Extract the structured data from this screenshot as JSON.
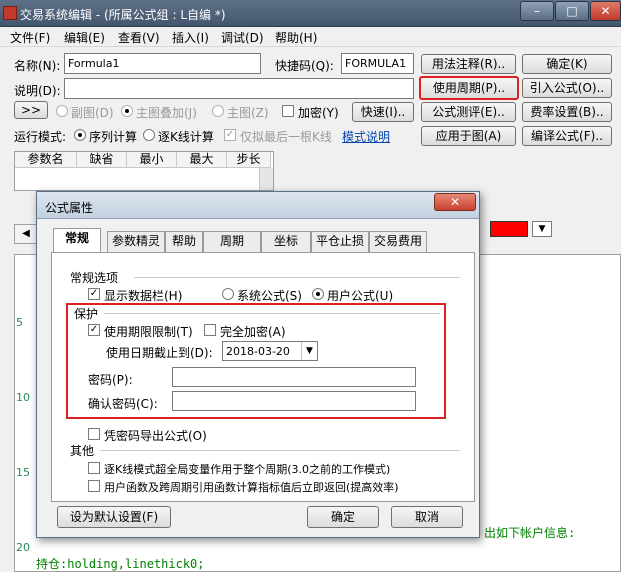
{
  "window": {
    "title": "交易系统编辑 - (所属公式组 : L自编 *)",
    "minimize": "–",
    "maximize": "□",
    "close": "✕"
  },
  "menu": [
    "文件(F)",
    "编辑(E)",
    "查看(V)",
    "插入(I)",
    "调试(D)",
    "帮助(H)"
  ],
  "form": {
    "name_label": "名称(N):",
    "name_value": "Formula1",
    "shortcut_label": "快捷码(Q):",
    "shortcut_value": "FORMULA1",
    "desc_label": "说明(D):",
    "desc_value": ""
  },
  "buttons": {
    "usage_note": "用法注释(R)..",
    "confirm": "确定(K)",
    "use_period": "使用周期(P)..",
    "import_formula": "引入公式(O)..",
    "formula_test": "公式测评(E)..",
    "fee_setting": "费率设置(B)..",
    "apply_to_chart": "应用于图(A)",
    "compile_formula": "编译公式(F)..",
    "expand": ">>",
    "quick": "快速(I).."
  },
  "options_row": {
    "subchart": "副图(D)",
    "main_overlay": "主图叠加(J)",
    "main_chart": "主图(Z)",
    "encrypt": "加密(Y)"
  },
  "run_mode": {
    "label": "运行模式:",
    "sequential": "序列计算",
    "bar_by_bar": "逐K线计算",
    "last_bar_only": "仅拟最后一根K线",
    "mode_help": "模式说明"
  },
  "param_table": {
    "headers": [
      "参数名",
      "缺省",
      "最小",
      "最大",
      "步长"
    ]
  },
  "editor": {
    "line_numbers": [
      "5",
      "10",
      "15",
      "20"
    ],
    "last_line": "持仓:holding,linethick0;",
    "side_text": "出如下帐户信息:"
  },
  "dialog": {
    "title": "公式属性",
    "close": "✕",
    "tabs": [
      "常规",
      "参数精灵",
      "帮助",
      "周期",
      "坐标",
      "平仓止损",
      "交易费用"
    ],
    "active_tab": "常规",
    "general_options": {
      "heading": "常规选项",
      "show_data_bar": "显示数据栏(H)",
      "show_data_bar_checked": true,
      "system_formula": "系统公式(S)",
      "user_formula": "用户公式(U)",
      "selected": "用户公式(U)"
    },
    "protection": {
      "heading": "保护",
      "use_time_limit": "使用期限限制(T)",
      "use_time_limit_checked": true,
      "full_encrypt": "完全加密(A)",
      "full_encrypt_checked": false,
      "expiry_label": "使用日期截止到(D):",
      "expiry_date": "2018-03-20",
      "password_label": "密码(P):",
      "password_value": "",
      "confirm_password_label": "确认密码(C):",
      "confirm_password_value": ""
    },
    "export_with_password": "凭密码导出公式(O)",
    "other": {
      "heading": "其他",
      "option1": "逐K线模式超全局变量作用于整个周期(3.0之前的工作模式)",
      "option2": "用户函数及跨周期引用函数计算指标值后立即返回(提高效率)"
    },
    "set_default": "设为默认设置(F)",
    "ok": "确定",
    "cancel": "取消"
  },
  "colors": {
    "highlight_box": "#e02020",
    "swatch": "#ff0000",
    "code_green": "#008000"
  }
}
